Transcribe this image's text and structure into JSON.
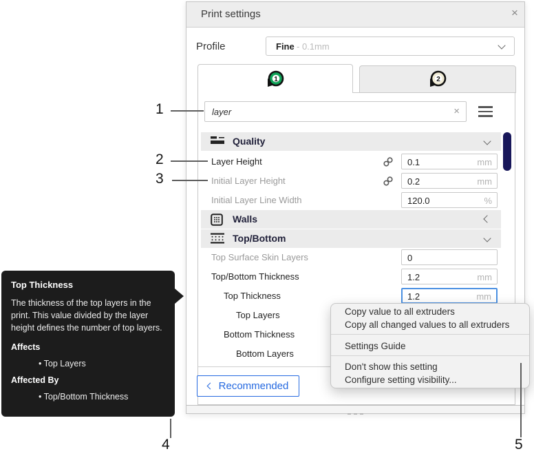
{
  "panel": {
    "title": "Print settings",
    "close_icon": "×",
    "profile": {
      "label": "Profile",
      "value": "Fine",
      "suffix": "- 0.1mm"
    },
    "tabs": {
      "one": "1",
      "two": "2"
    },
    "search": {
      "value": "layer",
      "clear_icon": "×"
    },
    "footer": {
      "recommended": "Recommended"
    }
  },
  "sections": {
    "quality": {
      "label": "Quality"
    },
    "walls": {
      "label": "Walls"
    },
    "top_bottom": {
      "label": "Top/Bottom"
    }
  },
  "rows": {
    "layer_height": {
      "label": "Layer Height",
      "value": "0.1",
      "unit": "mm"
    },
    "initial_layer_height": {
      "label": "Initial Layer Height",
      "value": "0.2",
      "unit": "mm"
    },
    "initial_layer_line_width": {
      "label": "Initial Layer Line Width",
      "value": "120.0",
      "unit": "%"
    },
    "top_surface_skin_layers": {
      "label": "Top Surface Skin Layers",
      "value": "0",
      "unit": ""
    },
    "top_bottom_thickness": {
      "label": "Top/Bottom Thickness",
      "value": "1.2",
      "unit": "mm"
    },
    "top_thickness": {
      "label": "Top Thickness",
      "value": "1.2",
      "unit": "mm"
    },
    "top_layers": {
      "label": "Top Layers"
    },
    "bottom_thickness": {
      "label": "Bottom Thickness"
    },
    "bottom_layers": {
      "label": "Bottom Layers"
    }
  },
  "context_menu": {
    "items": [
      "Copy value to all extruders",
      "Copy all changed values to all extruders",
      "Settings Guide",
      "Don't show this setting",
      "Configure setting visibility..."
    ]
  },
  "tooltip": {
    "title": "Top Thickness",
    "body": "The thickness of the top layers in the print. This value divided by the layer height defines the number of top layers.",
    "affects_label": "Affects",
    "affects_item": "• Top Layers",
    "affected_by_label": "Affected By",
    "affected_by_item": "• Top/Bottom Thickness"
  },
  "annotations": {
    "n1": "1",
    "n2": "2",
    "n3": "3",
    "n4": "4",
    "n5": "5"
  },
  "colors": {
    "accent_blue": "#2569e0",
    "focus_blue": "#4a90e2",
    "scrollbar_navy": "#18175a",
    "extruder1_ring": "#10a459",
    "extruder2_ring": "#f1ecd6",
    "tooltip_bg": "#1c1c1c"
  }
}
